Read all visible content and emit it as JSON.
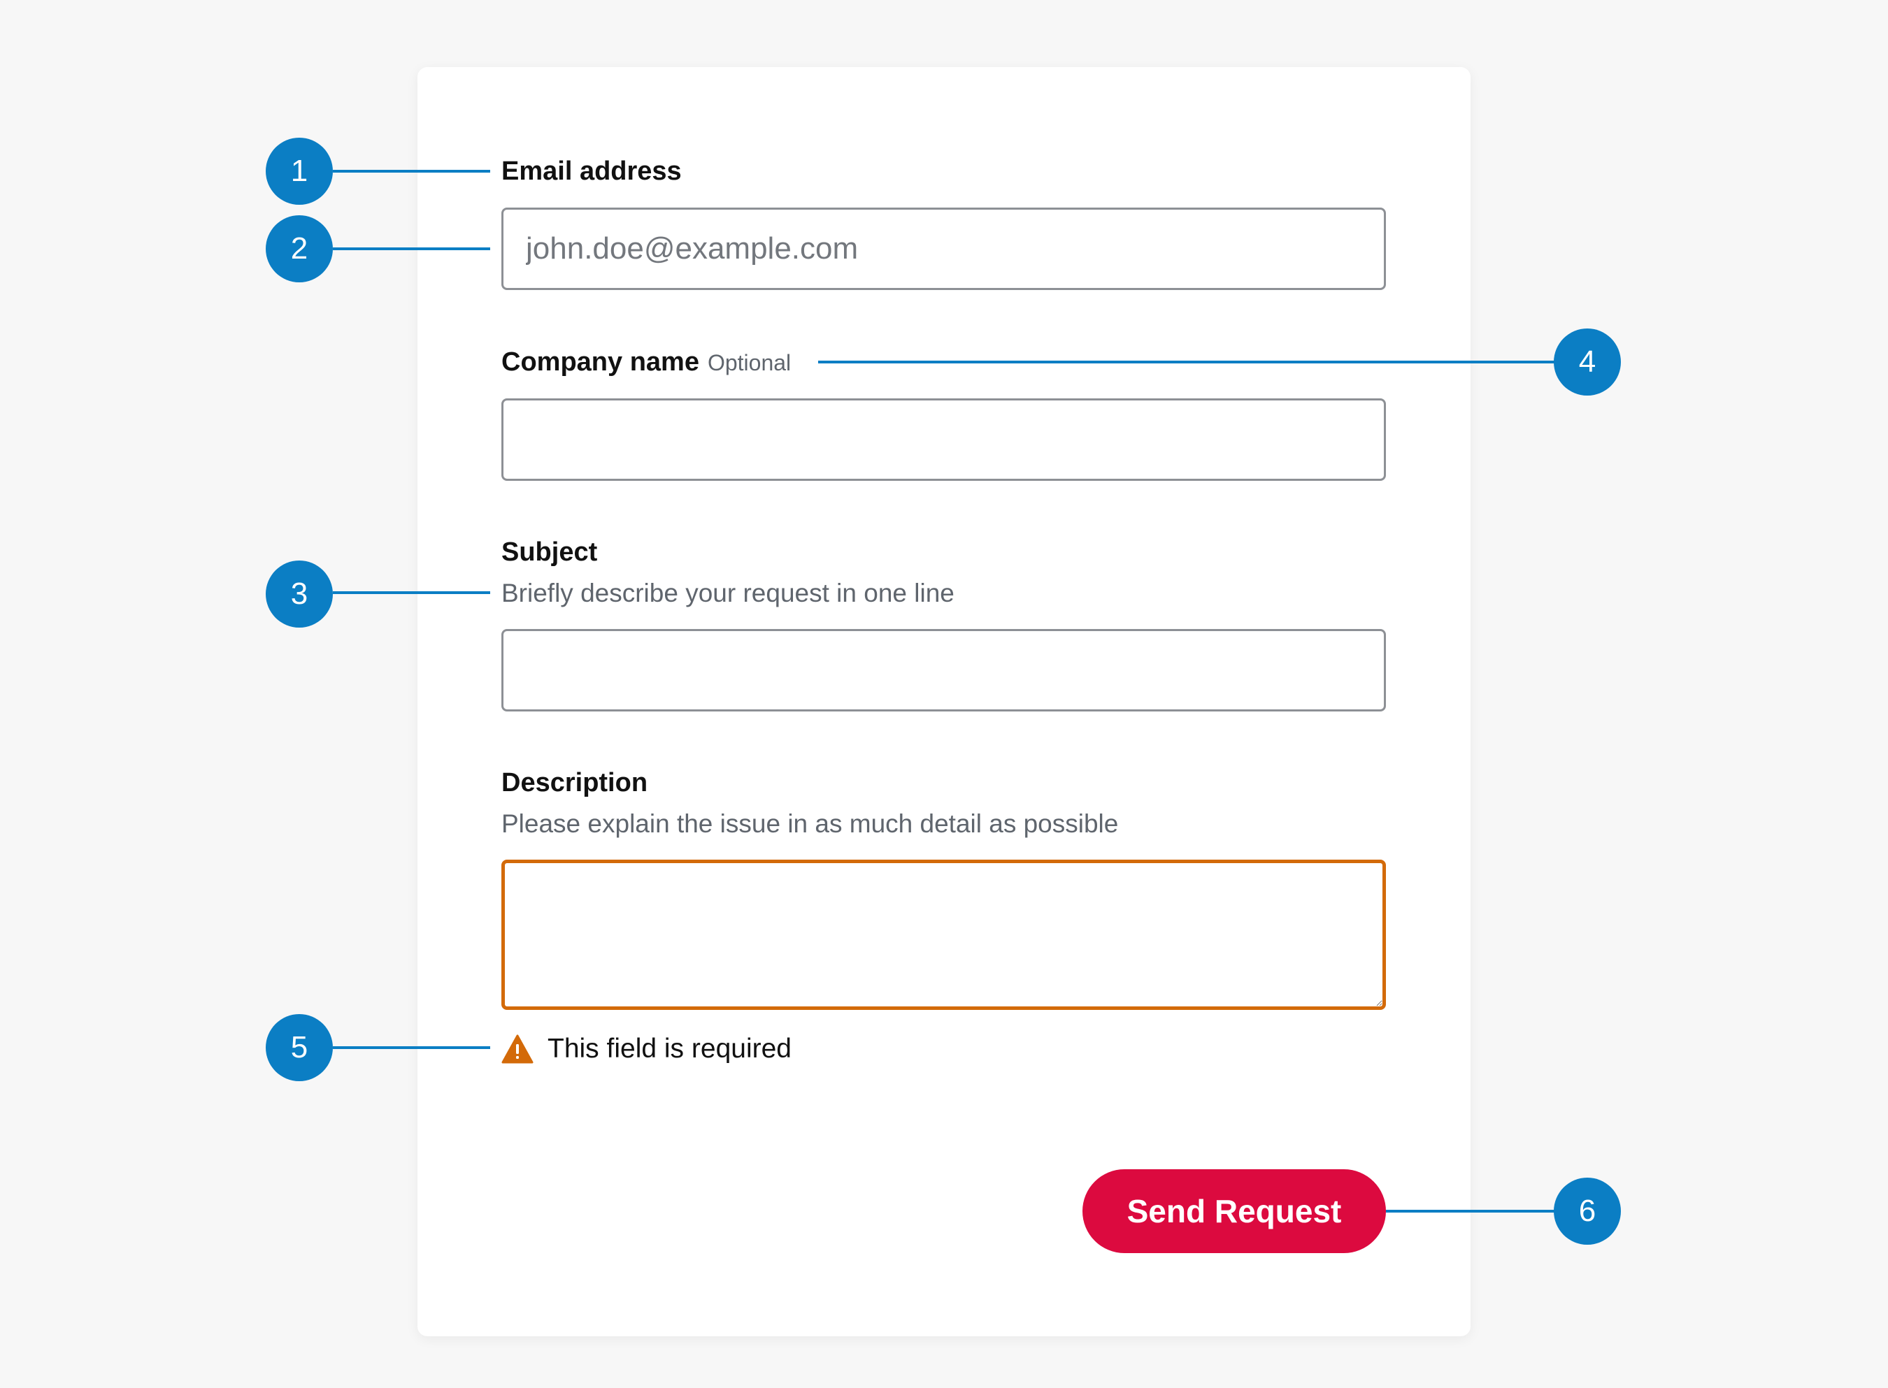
{
  "form": {
    "email": {
      "label": "Email address",
      "placeholder": "john.doe@example.com"
    },
    "company": {
      "label": "Company name",
      "optional_tag": "Optional"
    },
    "subject": {
      "label": "Subject",
      "hint": "Briefly describe your request in one line"
    },
    "description": {
      "label": "Description",
      "hint": "Please explain the issue in as much detail as possible",
      "error": "This field is required"
    },
    "submit_label": "Send Request"
  },
  "callouts": [
    "1",
    "2",
    "3",
    "4",
    "5",
    "6"
  ],
  "colors": {
    "callout": "#0b7ec4",
    "error": "#d36a09",
    "primary_button": "#dc0a3f"
  }
}
